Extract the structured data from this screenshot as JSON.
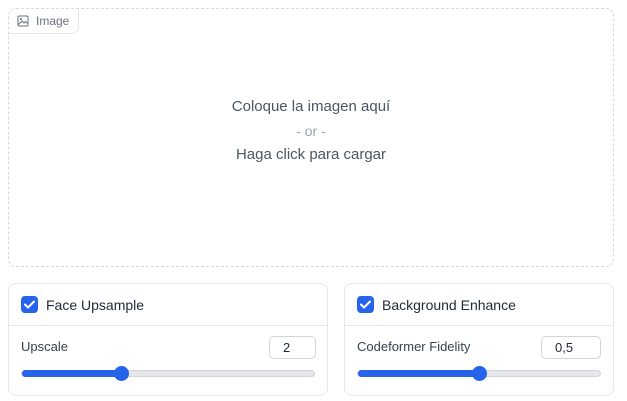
{
  "image_upload": {
    "tab_label": "Image",
    "drop_text": "Coloque la imagen aquí",
    "or_text": "- or -",
    "click_text": "Haga click para cargar"
  },
  "face_panel": {
    "checkbox_label": "Face Upsample",
    "checked": true,
    "slider_label": "Upscale",
    "value": "2",
    "fraction": 0.34
  },
  "background_panel": {
    "checkbox_label": "Background Enhance",
    "checked": true,
    "slider_label": "Codeformer Fidelity",
    "value": "0,5",
    "fraction": 0.5
  },
  "colors": {
    "accent": "#2563eb",
    "border": "#e5e7eb"
  },
  "icons": {
    "image_tab": "image-icon",
    "checkbox": "check-icon"
  }
}
